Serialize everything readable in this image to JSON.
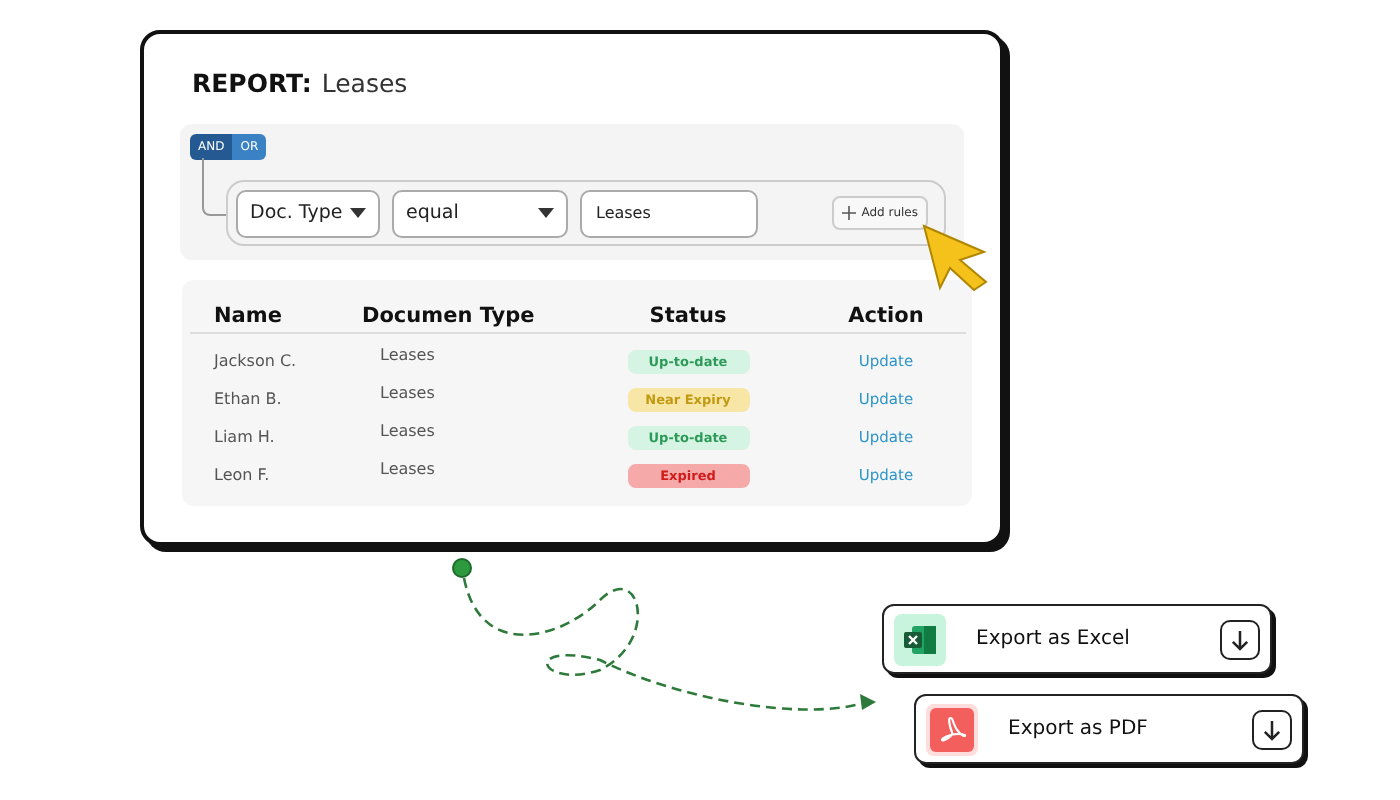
{
  "report": {
    "label": "REPORT:",
    "title": "Leases"
  },
  "logic": [
    {
      "label": "AND",
      "selected": true
    },
    {
      "label": "OR",
      "selected": false
    }
  ],
  "rule": {
    "field": "Doc. Type",
    "operator": "equal",
    "value": "Leases",
    "add_button": "Add rules"
  },
  "table": {
    "columns": [
      "Name",
      "Documen Type",
      "Status",
      "Action"
    ],
    "rows": [
      {
        "name": "Jackson C.",
        "doc_type": "Leases",
        "status": {
          "label": "Up-to-date",
          "kind": "ok"
        },
        "action": "Update"
      },
      {
        "name": "Ethan B.",
        "doc_type": "Leases",
        "status": {
          "label": "Near Expiry",
          "kind": "warn"
        },
        "action": "Update"
      },
      {
        "name": "Liam H.",
        "doc_type": "Leases",
        "status": {
          "label": "Up-to-date",
          "kind": "ok"
        },
        "action": "Update"
      },
      {
        "name": "Leon F.",
        "doc_type": "Leases",
        "status": {
          "label": "Expired",
          "kind": "error"
        },
        "action": "Update"
      }
    ]
  },
  "exports": [
    {
      "label": "Export as Excel",
      "kind": "excel"
    },
    {
      "label": "Export as PDF",
      "kind": "pdf"
    }
  ]
}
